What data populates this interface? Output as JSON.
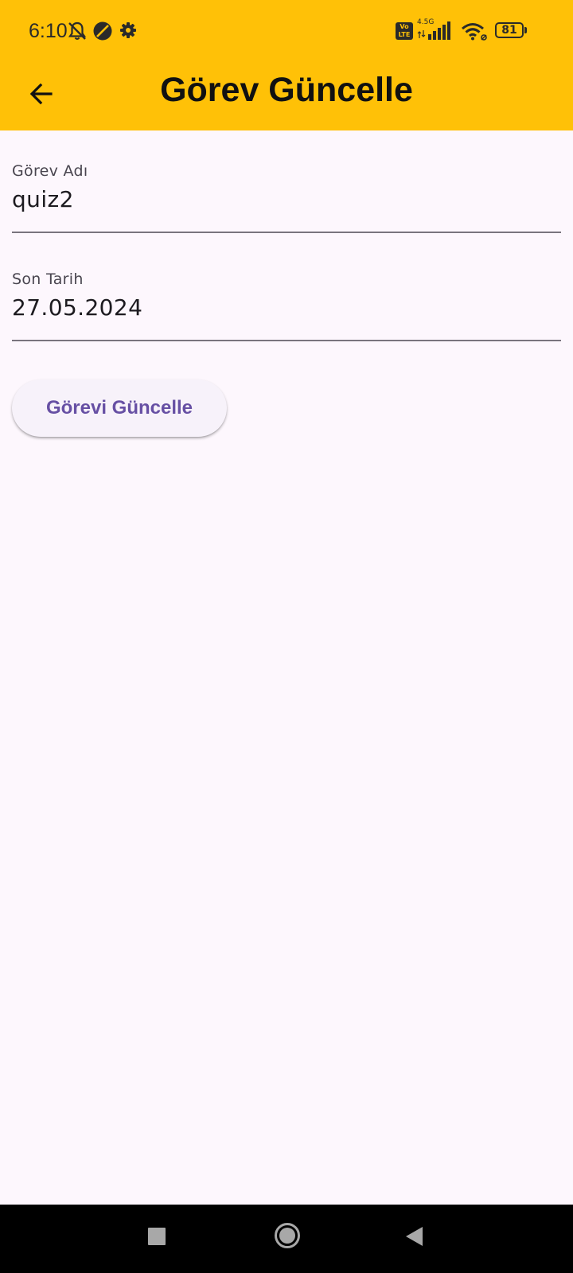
{
  "status_bar": {
    "time": "6:10",
    "battery": "81",
    "network": "4.5G",
    "volte_line1": "Vo",
    "volte_line2": "LTE",
    "icons": [
      "bell-off-icon",
      "do-not-disturb-icon",
      "settings-gear-icon",
      "volte-icon",
      "signal-icon",
      "wifi-icon",
      "battery-icon"
    ]
  },
  "app_bar": {
    "title": "Görev Güncelle",
    "back_icon": "arrow-left-icon"
  },
  "form": {
    "task_name": {
      "label": "Görev Adı",
      "value": "quiz2"
    },
    "due_date": {
      "label": "Son Tarih",
      "value": "27.05.2024"
    },
    "submit_label": "Görevi Güncelle"
  },
  "nav_bar": {
    "icons": [
      "recents-square-icon",
      "home-circle-icon",
      "back-triangle-icon"
    ]
  },
  "colors": {
    "app_bar": "#FFC107",
    "background": "#FDF7FD",
    "button_text": "#6750A4",
    "button_bg": "#F7F2FA"
  }
}
